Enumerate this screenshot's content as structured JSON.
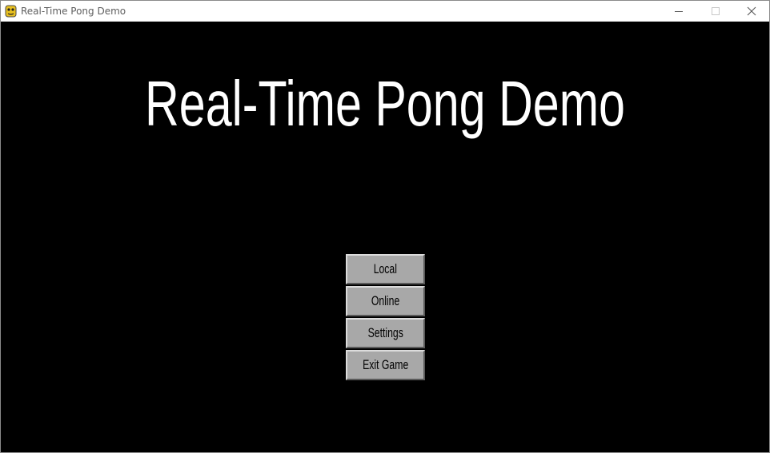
{
  "window": {
    "title": "Real-Time Pong Demo",
    "app_icon": "pygame-snake-icon",
    "controls": {
      "minimize_icon": "minimize-icon",
      "maximize_icon": "maximize-icon",
      "close_icon": "close-icon"
    }
  },
  "game": {
    "title": "Real-Time Pong Demo",
    "background_color": "#000000",
    "title_color": "#ffffff",
    "menu": {
      "button_color": "#a8a8a8",
      "buttons": [
        {
          "label": "Local"
        },
        {
          "label": "Online"
        },
        {
          "label": "Settings"
        },
        {
          "label": "Exit Game"
        }
      ]
    }
  }
}
